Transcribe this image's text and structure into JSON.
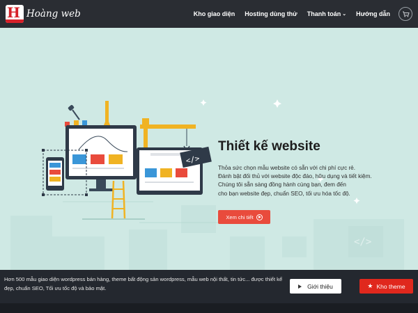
{
  "header": {
    "logo_text": "Hoàng web",
    "nav": [
      {
        "label": "Kho giao diện",
        "has_dropdown": false
      },
      {
        "label": "Hosting dùng thử",
        "has_dropdown": false
      },
      {
        "label": "Thanh toán",
        "has_dropdown": true
      },
      {
        "label": "Hướng dẫn",
        "has_dropdown": false
      }
    ],
    "cart_icon": "cart-icon"
  },
  "hero": {
    "title": "Thiết kế website",
    "desc_lines": [
      "Thỏa sức chọn mẫu website có sẵn với chi phí cực rẻ.",
      "Đánh bật đối thủ với website độc đáo, hữu dụng và tiết kiệm.",
      "Chúng tôi sẵn sàng đồng hành cùng bạn, đem đến",
      "cho bạn website đẹp, chuẩn SEO, tối ưu hóa tốc độ."
    ],
    "cta_label": "Xem chi tiết",
    "code_label": "</>"
  },
  "bottom": {
    "text": "Hơn 500 mẫu giao diện wordpress bán hàng, theme bất động sản wordpress, mẫu web nội thất, tin tức... được thiết kế đẹp, chuẩn SEO, Tối ưu tốc độ và bảo mật.",
    "intro_label": "Giới thiệu",
    "theme_label": "Kho theme"
  },
  "colors": {
    "header_bg": "#2a2d33",
    "hero_bg": "#cfe9e4",
    "accent_red": "#e0281d",
    "cta_red": "#e94b3c",
    "bottom_bg": "#24282f"
  }
}
